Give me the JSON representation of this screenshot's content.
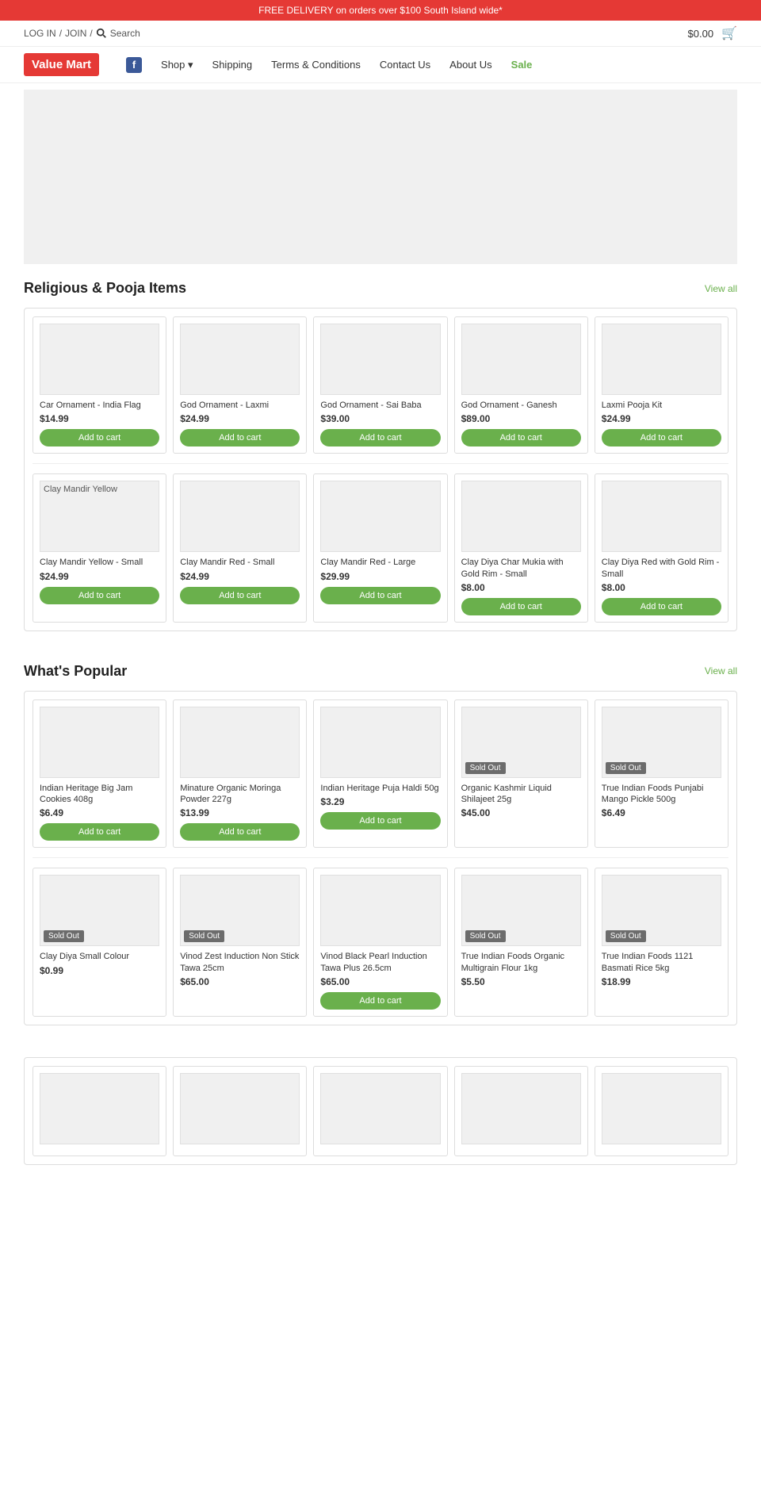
{
  "top_banner": {
    "text": "FREE DELIVERY on orders over $100 South Island wide*"
  },
  "top_bar": {
    "login": "LOG IN",
    "separator1": "/",
    "join": "JOIN",
    "separator2": "/",
    "search_label": "Search",
    "cart_amount": "$0.00"
  },
  "nav": {
    "logo": "Value Mart",
    "items": [
      {
        "label": "Shop",
        "has_dropdown": true
      },
      {
        "label": "Shipping"
      },
      {
        "label": "Terms & Conditions"
      },
      {
        "label": "Contact Us"
      },
      {
        "label": "About Us"
      },
      {
        "label": "Sale",
        "is_sale": true
      }
    ]
  },
  "sections": [
    {
      "id": "religious",
      "title": "Religious & Pooja Items",
      "view_all": "View all",
      "rows": [
        [
          {
            "name": "Car Ornament - India Flag",
            "price": "$14.99",
            "sold_out": false,
            "has_button": true,
            "button_label": "Add to cart"
          },
          {
            "name": "God Ornament - Laxmi",
            "price": "$24.99",
            "sold_out": false,
            "has_button": true,
            "button_label": "Add to cart"
          },
          {
            "name": "God Ornament - Sai Baba",
            "price": "$39.00",
            "sold_out": false,
            "has_button": true,
            "button_label": "Add to cart"
          },
          {
            "name": "God Ornament - Ganesh",
            "price": "$89.00",
            "sold_out": false,
            "has_button": true,
            "button_label": "Add to cart"
          },
          {
            "name": "Laxmi Pooja Kit",
            "price": "$24.99",
            "sold_out": false,
            "has_button": true,
            "button_label": "Add to cart"
          }
        ],
        [
          {
            "name": "Clay Mandir Yellow - Small",
            "price": "$24.99",
            "sold_out": false,
            "has_button": true,
            "button_label": "Add to cart",
            "label": "Clay Mandir Yellow"
          },
          {
            "name": "Clay Mandir Red - Small",
            "price": "$24.99",
            "sold_out": false,
            "has_button": true,
            "button_label": "Add to cart"
          },
          {
            "name": "Clay Mandir Red - Large",
            "price": "$29.99",
            "sold_out": false,
            "has_button": true,
            "button_label": "Add to cart"
          },
          {
            "name": "Clay Diya Char Mukia with Gold Rim - Small",
            "price": "$8.00",
            "sold_out": false,
            "has_button": true,
            "button_label": "Add to cart"
          },
          {
            "name": "Clay Diya Red with Gold Rim - Small",
            "price": "$8.00",
            "sold_out": false,
            "has_button": true,
            "button_label": "Add to cart"
          }
        ]
      ]
    },
    {
      "id": "popular",
      "title": "What's Popular",
      "view_all": "View all",
      "rows": [
        [
          {
            "name": "Indian Heritage Big Jam Cookies 408g",
            "price": "$6.49",
            "sold_out": false,
            "has_button": true,
            "button_label": "Add to cart"
          },
          {
            "name": "Minature Organic Moringa Powder 227g",
            "price": "$13.99",
            "sold_out": false,
            "has_button": true,
            "button_label": "Add to cart"
          },
          {
            "name": "Indian Heritage Puja Haldi 50g",
            "price": "$3.29",
            "sold_out": false,
            "has_button": true,
            "button_label": "Add to cart"
          },
          {
            "name": "Organic Kashmir Liquid Shilajeet 25g",
            "price": "$45.00",
            "sold_out": true,
            "has_button": false
          },
          {
            "name": "True Indian Foods Punjabi Mango Pickle 500g",
            "price": "$6.49",
            "sold_out": true,
            "has_button": false
          }
        ],
        [
          {
            "name": "Clay Diya Small Colour",
            "price": "$0.99",
            "sold_out": true,
            "has_button": false
          },
          {
            "name": "Vinod Zest Induction Non Stick Tawa 25cm",
            "price": "$65.00",
            "sold_out": true,
            "has_button": false
          },
          {
            "name": "Vinod Black Pearl Induction Tawa Plus 26.5cm",
            "price": "$65.00",
            "sold_out": false,
            "has_button": true,
            "button_label": "Add to cart"
          },
          {
            "name": "True Indian Foods Organic Multigrain Flour 1kg",
            "price": "$5.50",
            "sold_out": true,
            "has_button": false
          },
          {
            "name": "True Indian Foods 1121 Basmati Rice 5kg",
            "price": "$18.99",
            "sold_out": true,
            "has_button": false
          }
        ]
      ]
    }
  ],
  "bottom_section": {
    "has_items": true,
    "items": [
      {
        "empty": true
      },
      {
        "empty": true
      },
      {
        "empty": true
      },
      {
        "empty": true
      },
      {
        "empty": true
      }
    ]
  }
}
